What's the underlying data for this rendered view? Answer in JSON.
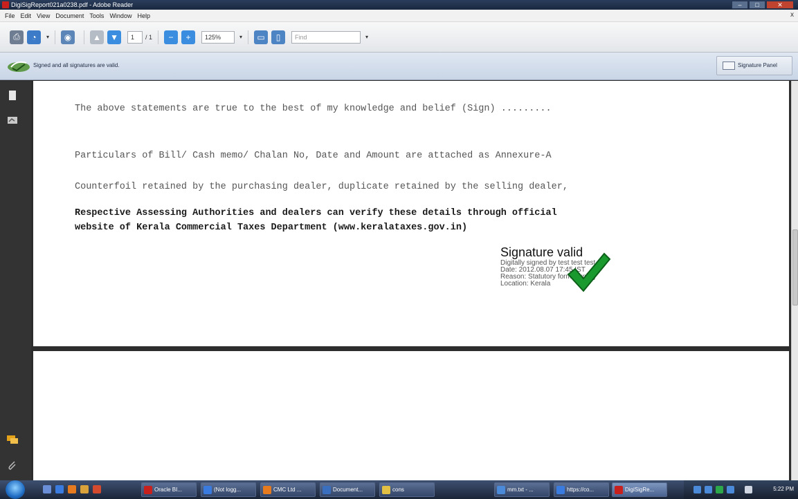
{
  "window": {
    "title": "DigiSigReport021a0238.pdf - Adobe Reader",
    "controls": {
      "minimize": "–",
      "maximize": "□",
      "close": "✕"
    }
  },
  "menubar": {
    "items": [
      "File",
      "Edit",
      "View",
      "Document",
      "Tools",
      "Window",
      "Help"
    ],
    "close": "x"
  },
  "toolbar": {
    "page_current": "1",
    "page_total": "/ 1",
    "zoom": "125%",
    "find_placeholder": "Find"
  },
  "message_bar": {
    "text": "Signed and all signatures are valid.",
    "signature_panel_label": "Signature Panel"
  },
  "document": {
    "lines": [
      "The above statements are true to the best of my knowledge and belief (Sign) .........",
      "Particulars of Bill/ Cash memo/ Chalan No, Date and Amount are attached as Annexure-A",
      "Counterfoil retained by the purchasing dealer, duplicate retained by the selling dealer,"
    ],
    "bold_lines": [
      "Respective Assessing Authorities and dealers can verify these details through official",
      "website of Kerala Commercial Taxes Department (www.keralataxes.gov.in)"
    ],
    "signature": {
      "title": "Signature valid",
      "signed_by": "Digitally signed by test test test",
      "date": "Date: 2012.08.07 17:45 IST",
      "reason": "Reason: Statutory form signing",
      "location": "Location: Kerala"
    }
  },
  "taskbar": {
    "buttons": [
      "Oracle BI...",
      "(Not logg...",
      "CMC Ltd ...",
      "Document...",
      "cons",
      "mm.txt - ...",
      "https://co...",
      "DigiSigRe..."
    ],
    "clock": "5:22 PM"
  },
  "colors": {
    "accent": "#1f6cc4",
    "checkmark": "#1a9a2e",
    "pdf_red": "#c8201c"
  }
}
